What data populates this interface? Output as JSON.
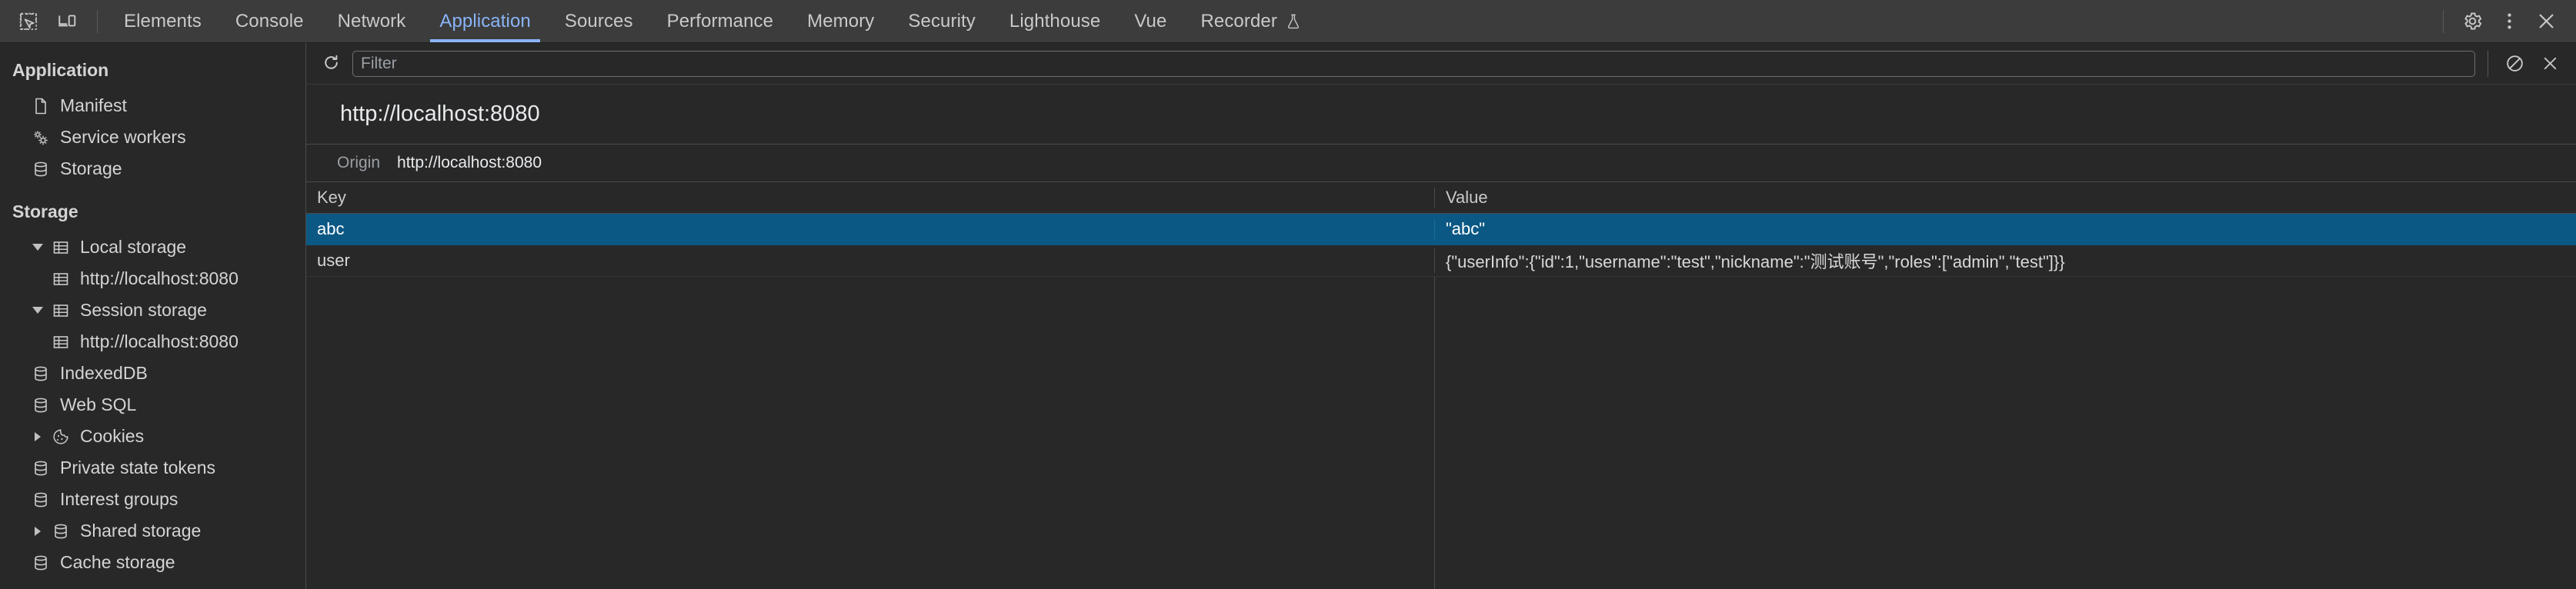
{
  "toolbar": {
    "inspect_icon": "inspect-element-icon",
    "device_icon": "device-toolbar-icon",
    "tabs": [
      {
        "label": "Elements",
        "active": false
      },
      {
        "label": "Console",
        "active": false
      },
      {
        "label": "Network",
        "active": false
      },
      {
        "label": "Application",
        "active": true
      },
      {
        "label": "Sources",
        "active": false
      },
      {
        "label": "Performance",
        "active": false
      },
      {
        "label": "Memory",
        "active": false
      },
      {
        "label": "Security",
        "active": false
      },
      {
        "label": "Lighthouse",
        "active": false
      },
      {
        "label": "Vue",
        "active": false
      },
      {
        "label": "Recorder",
        "active": false,
        "icon": "flask-icon"
      }
    ],
    "settings_icon": "gear-icon",
    "more_icon": "kebab-menu-icon",
    "close_icon": "close-icon",
    "accent_color": "#8ab4f8"
  },
  "sidebar": {
    "application_title": "Application",
    "application_items": [
      {
        "label": "Manifest",
        "icon": "document-icon"
      },
      {
        "label": "Service workers",
        "icon": "gears-icon"
      },
      {
        "label": "Storage",
        "icon": "database-icon"
      }
    ],
    "storage_title": "Storage",
    "storage_items": [
      {
        "label": "Local storage",
        "icon": "table-icon",
        "twisty": "open",
        "indent": 0
      },
      {
        "label": "http://localhost:8080",
        "icon": "table-icon",
        "twisty": "none",
        "indent": 1
      },
      {
        "label": "Session storage",
        "icon": "table-icon",
        "twisty": "open",
        "indent": 0
      },
      {
        "label": "http://localhost:8080",
        "icon": "table-icon",
        "twisty": "none",
        "indent": 1
      },
      {
        "label": "IndexedDB",
        "icon": "database-icon",
        "twisty": "none",
        "indent": 0
      },
      {
        "label": "Web SQL",
        "icon": "database-icon",
        "twisty": "none",
        "indent": 0
      },
      {
        "label": "Cookies",
        "icon": "cookie-icon",
        "twisty": "closed",
        "indent": 0
      },
      {
        "label": "Private state tokens",
        "icon": "database-icon",
        "twisty": "none",
        "indent": 0
      },
      {
        "label": "Interest groups",
        "icon": "database-icon",
        "twisty": "none",
        "indent": 0
      },
      {
        "label": "Shared storage",
        "icon": "database-icon",
        "twisty": "closed",
        "indent": 0
      },
      {
        "label": "Cache storage",
        "icon": "database-icon",
        "twisty": "none",
        "indent": 0
      }
    ]
  },
  "panel": {
    "refresh_icon": "refresh-icon",
    "filter_placeholder": "Filter",
    "filter_value": "",
    "clear_icon": "clear-all-icon",
    "delete_icon": "delete-selected-icon",
    "origin_title": "http://localhost:8080",
    "origin_label": "Origin",
    "origin_value": "http://localhost:8080",
    "columns": [
      "Key",
      "Value"
    ],
    "rows": [
      {
        "key": "abc",
        "value": "\"abc\"",
        "selected": true
      },
      {
        "key": "user",
        "value": "{\"userInfo\":{\"id\":1,\"username\":\"test\",\"nickname\":\"测试账号\",\"roles\":[\"admin\",\"test\"]}}",
        "selected": false
      }
    ],
    "selection_color": "#0b5884"
  }
}
